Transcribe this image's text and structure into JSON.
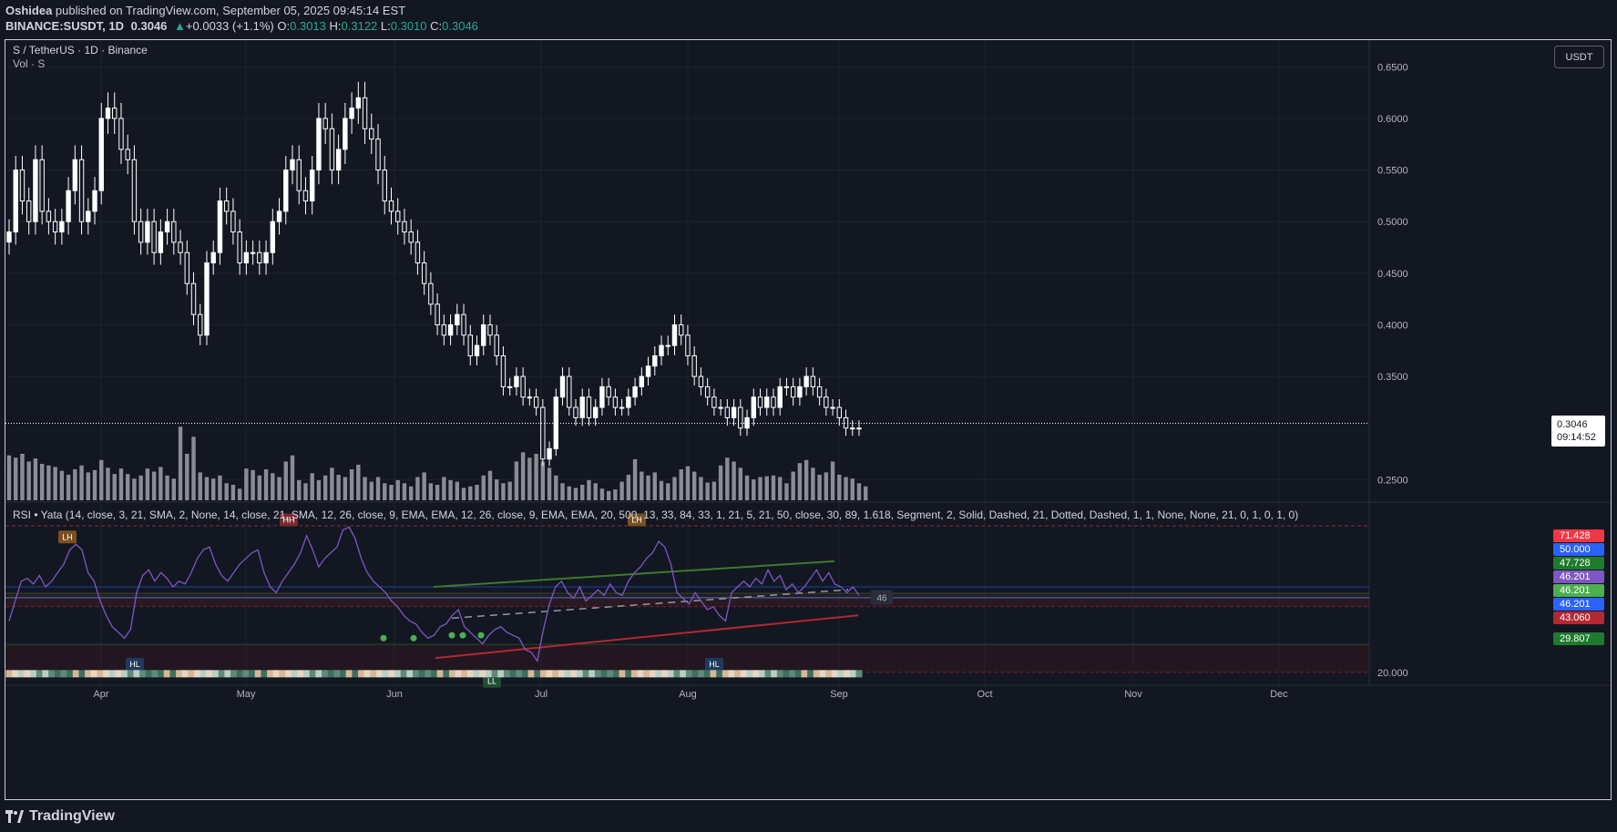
{
  "header": {
    "publisher": "Oshidea",
    "published_text": "published on TradingView.com, September 05, 2025 09:45:14 EST",
    "symbol": "BINANCE:SUSDT, 1D",
    "price": "0.3046",
    "change": "+0.0033 (+1.1%)",
    "o_label": "O:",
    "o_value": "0.3013",
    "h_label": "H:",
    "h_value": "0.3122",
    "l_label": "L:",
    "l_value": "0.3010",
    "c_label": "C:",
    "c_value": "0.3046"
  },
  "legend": {
    "title": "S / TetherUS · 1D · Binance",
    "volume": "Vol · S",
    "rsi": "RSI • Yata (14, close, 3, 21, SMA, 2, None, 14, close, 21, SMA, 12, 26, close, 9, EMA, EMA, 12, 26, close, 9, EMA, EMA, 20, 500, 13, 33, 84, 33, 1, 21, 5, 21, 50, close, 30, 89, 1.618, Segment, 2, Solid, Dashed, 21, Dotted, Dashed, 1, 1, None, None, 21, 0, 1, 0, 1, 0)"
  },
  "currency_button": "USDT",
  "last_price": {
    "value": "0.3046",
    "countdown": "09:14:52"
  },
  "footer": {
    "brand": "TradingView"
  },
  "colors": {
    "background": "#131722",
    "candle": "#ffffff",
    "volume": "#8a8d95",
    "rsi_line": "#7e57c2",
    "support": "#b22833",
    "resistance": "#3d7a2a"
  },
  "chart_data": [
    {
      "type": "candlestick",
      "title": "S / TetherUS · 1D · Binance",
      "x_labels": [
        "Apr",
        "May",
        "Jun",
        "Jul",
        "Aug",
        "Sep",
        "Oct",
        "Nov",
        "Dec"
      ],
      "y_ticks": [
        "0.6500",
        "0.6000",
        "0.5500",
        "0.5000",
        "0.4500",
        "0.4000",
        "0.3500",
        "0.2500"
      ],
      "ylim": [
        0.23,
        0.66
      ],
      "last_close": 0.3046,
      "close_series": [
        0.49,
        0.55,
        0.52,
        0.5,
        0.56,
        0.51,
        0.5,
        0.49,
        0.5,
        0.53,
        0.56,
        0.5,
        0.51,
        0.53,
        0.6,
        0.61,
        0.6,
        0.57,
        0.56,
        0.5,
        0.48,
        0.5,
        0.47,
        0.49,
        0.5,
        0.48,
        0.47,
        0.44,
        0.41,
        0.39,
        0.46,
        0.47,
        0.52,
        0.51,
        0.49,
        0.46,
        0.47,
        0.47,
        0.46,
        0.47,
        0.5,
        0.51,
        0.55,
        0.56,
        0.53,
        0.52,
        0.55,
        0.6,
        0.59,
        0.55,
        0.57,
        0.6,
        0.61,
        0.62,
        0.59,
        0.58,
        0.55,
        0.52,
        0.51,
        0.5,
        0.49,
        0.48,
        0.46,
        0.44,
        0.42,
        0.4,
        0.39,
        0.4,
        0.41,
        0.39,
        0.37,
        0.38,
        0.4,
        0.39,
        0.37,
        0.34,
        0.34,
        0.35,
        0.33,
        0.33,
        0.32,
        0.27,
        0.28,
        0.33,
        0.35,
        0.32,
        0.31,
        0.33,
        0.31,
        0.32,
        0.34,
        0.33,
        0.32,
        0.32,
        0.33,
        0.34,
        0.35,
        0.36,
        0.37,
        0.38,
        0.38,
        0.4,
        0.39,
        0.37,
        0.35,
        0.34,
        0.33,
        0.32,
        0.32,
        0.31,
        0.32,
        0.3,
        0.31,
        0.33,
        0.32,
        0.33,
        0.32,
        0.34,
        0.34,
        0.33,
        0.34,
        0.35,
        0.34,
        0.33,
        0.32,
        0.32,
        0.31,
        0.3,
        0.3,
        0.3
      ]
    },
    {
      "type": "bar",
      "title": "Vol · S",
      "values_relative": [
        0.58,
        0.55,
        0.6,
        0.5,
        0.54,
        0.47,
        0.45,
        0.43,
        0.38,
        0.33,
        0.4,
        0.45,
        0.36,
        0.39,
        0.52,
        0.42,
        0.34,
        0.41,
        0.34,
        0.28,
        0.32,
        0.41,
        0.37,
        0.43,
        0.32,
        0.28,
        0.95,
        0.6,
        0.82,
        0.36,
        0.3,
        0.28,
        0.32,
        0.22,
        0.2,
        0.15,
        0.41,
        0.39,
        0.32,
        0.4,
        0.35,
        0.3,
        0.5,
        0.58,
        0.26,
        0.22,
        0.35,
        0.26,
        0.32,
        0.42,
        0.33,
        0.3,
        0.4,
        0.46,
        0.3,
        0.24,
        0.3,
        0.22,
        0.2,
        0.26,
        0.22,
        0.18,
        0.3,
        0.36,
        0.22,
        0.2,
        0.3,
        0.26,
        0.24,
        0.16,
        0.18,
        0.2,
        0.32,
        0.38,
        0.27,
        0.22,
        0.24,
        0.5,
        0.62,
        0.55,
        0.6,
        0.5,
        0.42,
        0.32,
        0.22,
        0.18,
        0.16,
        0.2,
        0.26,
        0.22,
        0.15,
        0.12,
        0.14,
        0.24,
        0.33,
        0.53,
        0.37,
        0.32,
        0.36,
        0.25,
        0.22,
        0.3,
        0.4,
        0.44,
        0.37,
        0.3,
        0.23,
        0.24,
        0.45,
        0.55,
        0.5,
        0.42,
        0.32,
        0.27,
        0.3,
        0.31,
        0.32,
        0.3,
        0.22,
        0.37,
        0.48,
        0.52,
        0.42,
        0.33,
        0.36,
        0.5,
        0.33,
        0.3,
        0.28,
        0.22,
        0.18
      ]
    },
    {
      "type": "line",
      "title": "RSI",
      "y_ticks": [
        "20.000"
      ],
      "ylim": [
        18,
        74
      ],
      "levels": [
        {
          "label": "71.428",
          "color": "#f23645"
        },
        {
          "label": "50.000",
          "color": "#2962ff"
        },
        {
          "label": "47.728",
          "color": "#1e7a2c"
        },
        {
          "label": "46.201",
          "color": "#7e57c2"
        },
        {
          "label": "46.201",
          "color": "#4caf50"
        },
        {
          "label": "46.201",
          "color": "#2962ff"
        },
        {
          "label": "43.060",
          "color": "#b22833"
        },
        {
          "label": "29.807",
          "color": "#1e7a2c"
        }
      ],
      "pivot_labels": [
        {
          "text": "LH",
          "type": "high"
        },
        {
          "text": "HH",
          "type": "high"
        },
        {
          "text": "LH",
          "type": "high"
        },
        {
          "text": "HL",
          "type": "low"
        },
        {
          "text": "HL",
          "type": "low"
        },
        {
          "text": "LL",
          "type": "low"
        }
      ],
      "current_value_label": "46",
      "values": [
        38,
        45,
        52,
        53,
        51,
        54,
        50,
        52,
        55,
        58,
        63,
        65,
        63,
        55,
        52,
        45,
        40,
        36,
        34,
        32,
        35,
        48,
        54,
        56,
        52,
        55,
        53,
        50,
        52,
        51,
        55,
        60,
        63,
        64,
        58,
        54,
        52,
        55,
        58,
        60,
        62,
        63,
        55,
        50,
        48,
        52,
        55,
        58,
        62,
        68,
        63,
        57,
        60,
        62,
        64,
        70,
        71,
        67,
        60,
        55,
        52,
        50,
        48,
        45,
        43,
        40,
        38,
        37,
        34,
        32,
        33,
        36,
        37,
        40,
        42,
        36,
        34,
        32,
        30,
        33,
        35,
        36,
        34,
        33,
        32,
        28,
        27,
        24,
        35,
        44,
        50,
        52,
        48,
        46,
        50,
        45,
        47,
        49,
        47,
        51,
        48,
        47,
        52,
        55,
        57,
        60,
        62,
        66,
        64,
        58,
        48,
        46,
        44,
        48,
        45,
        42,
        43,
        40,
        38,
        48,
        50,
        52,
        50,
        53,
        51,
        56,
        52,
        54,
        49,
        51,
        48,
        50,
        53,
        56,
        52,
        55,
        51,
        50,
        48,
        50,
        47
      ]
    }
  ]
}
